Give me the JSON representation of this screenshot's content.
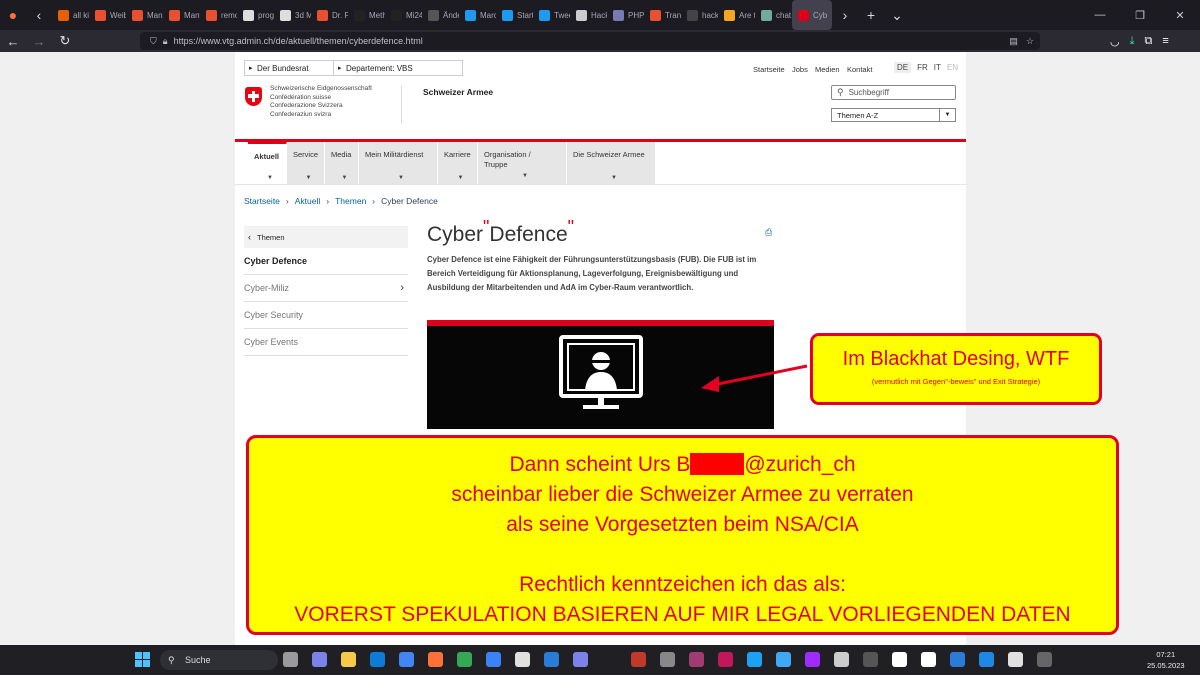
{
  "browser": {
    "tabs": [
      {
        "label": "all ki",
        "color": "#e66000"
      },
      {
        "label": "Weibl",
        "color": "#e8502f"
      },
      {
        "label": "Many",
        "color": "#e8502f"
      },
      {
        "label": "Many",
        "color": "#e8502f"
      },
      {
        "label": "remo",
        "color": "#e8502f"
      },
      {
        "label": "progi",
        "color": "#dddddd"
      },
      {
        "label": "3d Mi",
        "color": "#dddddd"
      },
      {
        "label": "Dr. Pe",
        "color": "#e8502f"
      },
      {
        "label": "Meth",
        "color": "#222222"
      },
      {
        "label": "Mi24",
        "color": "#222222"
      },
      {
        "label": "Ände",
        "color": "#555555"
      },
      {
        "label": "Marc",
        "color": "#1d9bf0"
      },
      {
        "label": "Startr",
        "color": "#1d9bf0"
      },
      {
        "label": "Tweet",
        "color": "#1d9bf0"
      },
      {
        "label": "Hacke",
        "color": "#cccccc"
      },
      {
        "label": "PHP:",
        "color": "#777bb3"
      },
      {
        "label": "Trans",
        "color": "#e8502f"
      },
      {
        "label": "hackersca",
        "color": "#444444"
      },
      {
        "label": "Are th",
        "color": "#f5a623"
      },
      {
        "label": "chat.",
        "color": "#74aa9c"
      },
      {
        "label": "Cyb",
        "color": "#dc0018"
      }
    ],
    "url": "https://www.vtg.admin.ch/de/aktuell/themen/cyberdefence.html"
  },
  "site": {
    "top_crumbs": [
      "Der Bundesrat",
      "Departement: VBS"
    ],
    "top_links": [
      "Startseite",
      "Jobs",
      "Medien",
      "Kontakt"
    ],
    "languages": [
      "DE",
      "FR",
      "IT",
      "EN"
    ],
    "confederation": [
      "Schweizerische Eidgenossenschaft",
      "Confédération suisse",
      "Confederazione Svizzera",
      "Confederaziun svizra"
    ],
    "department": "Schweizer Armee",
    "search_placeholder": "Suchbegriff",
    "themes_select": "Themen A-Z",
    "main_nav": [
      "Aktuell",
      "Service",
      "Media",
      "Mein Militärdienst",
      "Karriere",
      "Organisation / Truppe",
      "Die Schweizer Armee"
    ],
    "breadcrumb": [
      "Startseite",
      "Aktuell",
      "Themen",
      "Cyber Defence"
    ],
    "sidebar": {
      "back_label": "Themen",
      "items": [
        "Cyber Defence",
        "Cyber-Miliz",
        "Cyber Security",
        "Cyber Events"
      ]
    },
    "page_title": "Cyber Defence",
    "title_marks": "\"",
    "lead": "Cyber Defence ist eine Fähigkeit der Führungsunterstützungsbasis (FUB). Die FUB ist im Bereich Verteidigung für Aktionsplanung, Lageverfolgung, Ereignisbewältigung und Ausbildung der Mitarbeitenden und AdA im Cyber-Raum verantwortlich."
  },
  "annotations": {
    "callout_title": "Im Blackhat Desing, WTF",
    "callout_sub": "(vermutlich mit Gegen\"-beweis\" und Exit Strategie)",
    "note_line1_pre": "Dann scheint Urs B",
    "note_line1_post": "@zurich_ch",
    "note_line2": "scheinbar lieber die Schweizer Armee zu verraten",
    "note_line3": "als seine Vorgesetzten beim NSA/CIA",
    "note_line4": "Rechtlich kenntzeichen ich das als:",
    "note_line5": "VORERST SPEKULATION BASIEREN AUF MIR LEGAL VORLIEGENDEN DATEN"
  },
  "taskbar": {
    "search_label": "Suche",
    "time": "07:21",
    "date": "25.05.2023"
  }
}
